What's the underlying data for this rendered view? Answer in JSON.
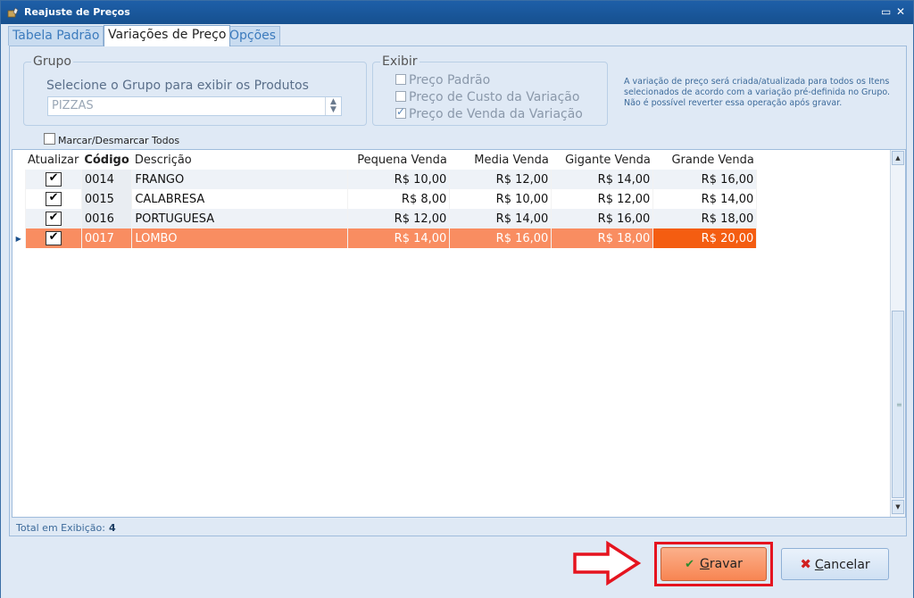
{
  "window": {
    "title": "Reajuste de Preços",
    "controls": "▭ ✕"
  },
  "tabs": [
    {
      "label": "Tabela Padrão",
      "active": false
    },
    {
      "label": "Variações de Preço",
      "active": true
    },
    {
      "label": "Opções",
      "active": false
    }
  ],
  "grupo": {
    "legend": "Grupo",
    "label": "Selecione o Grupo para exibir os Produtos",
    "selected": "PIZZAS"
  },
  "exibir": {
    "legend": "Exibir",
    "options": [
      {
        "label": "Preço Padrão",
        "checked": false
      },
      {
        "label": "Preço de Custo da Variação",
        "checked": false
      },
      {
        "label": "Preço de Venda da Variação",
        "checked": true
      }
    ]
  },
  "info_text": "A variação de preço será criada/atualizada para todos os Itens selecionados de acordo com a variação pré-definida no Grupo. Não é possível reverter essa operação após gravar.",
  "marcar_todos": "Marcar/Desmarcar Todos",
  "table": {
    "headers": {
      "atualizar": "Atualizar",
      "codigo": "Código",
      "descricao": "Descrição",
      "pequena": "Pequena Venda",
      "media": "Media Venda",
      "gigante": "Gigante Venda",
      "grande": "Grande Venda"
    },
    "rows": [
      {
        "codigo": "0014",
        "descricao": "FRANGO",
        "pequena": "R$ 10,00",
        "media": "R$ 12,00",
        "gigante": "R$ 14,00",
        "grande": "R$ 16,00"
      },
      {
        "codigo": "0015",
        "descricao": "CALABRESA",
        "pequena": "R$ 8,00",
        "media": "R$ 10,00",
        "gigante": "R$ 12,00",
        "grande": "R$ 14,00"
      },
      {
        "codigo": "0016",
        "descricao": "PORTUGUESA",
        "pequena": "R$ 12,00",
        "media": "R$ 14,00",
        "gigante": "R$ 16,00",
        "grande": "R$ 18,00"
      },
      {
        "codigo": "0017",
        "descricao": "LOMBO",
        "pequena": "R$ 14,00",
        "media": "R$ 16,00",
        "gigante": "R$ 18,00",
        "grande": "R$ 20,00"
      }
    ]
  },
  "total": {
    "label": "Total em Exibição:",
    "value": "4"
  },
  "buttons": {
    "gravar_prefix": "",
    "gravar_u": "G",
    "gravar_rest": "ravar",
    "cancelar_u": "C",
    "cancelar_rest": "ancelar"
  },
  "icons": {
    "gravar": "checkmark-icon",
    "cancelar": "x-icon",
    "annotation": "red-arrow-icon"
  },
  "colors": {
    "selected_row": "#f98d61",
    "hot_cell": "#f45d11",
    "highlight_box": "#e5141f"
  }
}
